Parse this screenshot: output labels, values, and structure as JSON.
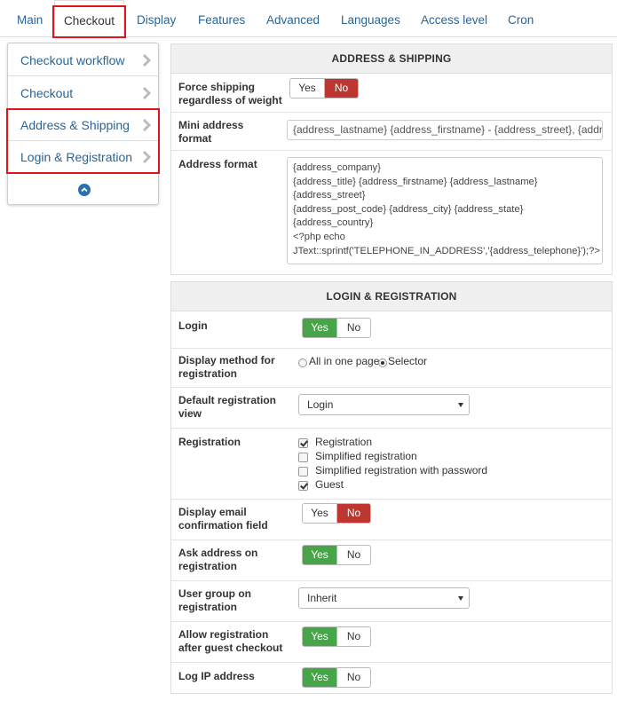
{
  "tabs": [
    {
      "label": "Main"
    },
    {
      "label": "Checkout"
    },
    {
      "label": "Display"
    },
    {
      "label": "Features"
    },
    {
      "label": "Advanced"
    },
    {
      "label": "Languages"
    },
    {
      "label": "Access level"
    },
    {
      "label": "Cron"
    }
  ],
  "active_tab": "Checkout",
  "sidebar": {
    "items": [
      {
        "label": "Checkout workflow",
        "icon": "chevron-right-icon"
      },
      {
        "label": "Checkout",
        "icon": "chevron-right-icon"
      },
      {
        "label": "Address & Shipping",
        "icon": "chevron-right-icon"
      },
      {
        "label": "Login & Registration",
        "icon": "chevron-right-icon"
      }
    ],
    "collapse_icon": "chevron-up-circle-icon"
  },
  "address_shipping": {
    "title": "ADDRESS & SHIPPING",
    "force_shipping": {
      "label_line1": "Force shipping",
      "label_line2": "regardless of weight",
      "yes": "Yes",
      "no": "No",
      "value": "No"
    },
    "mini_address": {
      "label_line1": "Mini address",
      "label_line2": "format",
      "value": "{address_lastname} {address_firstname} - {address_street}, {address"
    },
    "address_format": {
      "label": "Address format",
      "lines": [
        "{address_company}",
        "{address_title} {address_firstname} {address_lastname}",
        "{address_street}",
        "{address_post_code} {address_city} {address_state}",
        "{address_country}",
        "<?php echo",
        "JText::sprintf('TELEPHONE_IN_ADDRESS','{address_telephone}');?>"
      ]
    }
  },
  "login_registration": {
    "title": "LOGIN & REGISTRATION",
    "login": {
      "label": "Login",
      "yes": "Yes",
      "no": "No",
      "value": "Yes"
    },
    "display_method": {
      "label_line1": "Display method for",
      "label_line2": "registration",
      "opt1": "All in one page",
      "opt2": "Selector",
      "value": "Selector"
    },
    "default_view": {
      "label_line1": "Default registration",
      "label_line2": "view",
      "value": "Login"
    },
    "registration": {
      "label": "Registration",
      "options": [
        {
          "label": "Registration",
          "checked": true
        },
        {
          "label": "Simplified registration",
          "checked": false
        },
        {
          "label": "Simplified registration with password",
          "checked": false
        },
        {
          "label": "Guest",
          "checked": true
        }
      ]
    },
    "email_confirm": {
      "label_line1": "Display email",
      "label_line2": "confirmation field",
      "yes": "Yes",
      "no": "No",
      "value": "No"
    },
    "ask_address": {
      "label_line1": "Ask address on",
      "label_line2": "registration",
      "yes": "Yes",
      "no": "No",
      "value": "Yes"
    },
    "user_group": {
      "label_line1": "User group on",
      "label_line2": "registration",
      "value": "Inherit"
    },
    "allow_after_guest": {
      "label_line1": "Allow registration",
      "label_line2": "after guest checkout",
      "yes": "Yes",
      "no": "No",
      "value": "Yes"
    },
    "log_ip": {
      "label": "Log IP address",
      "yes": "Yes",
      "no": "No",
      "value": "Yes"
    }
  },
  "colors": {
    "link": "#2a6496",
    "highlight_red": "#e0151b",
    "toggle_green": "#46a546",
    "toggle_red": "#bd362f"
  }
}
